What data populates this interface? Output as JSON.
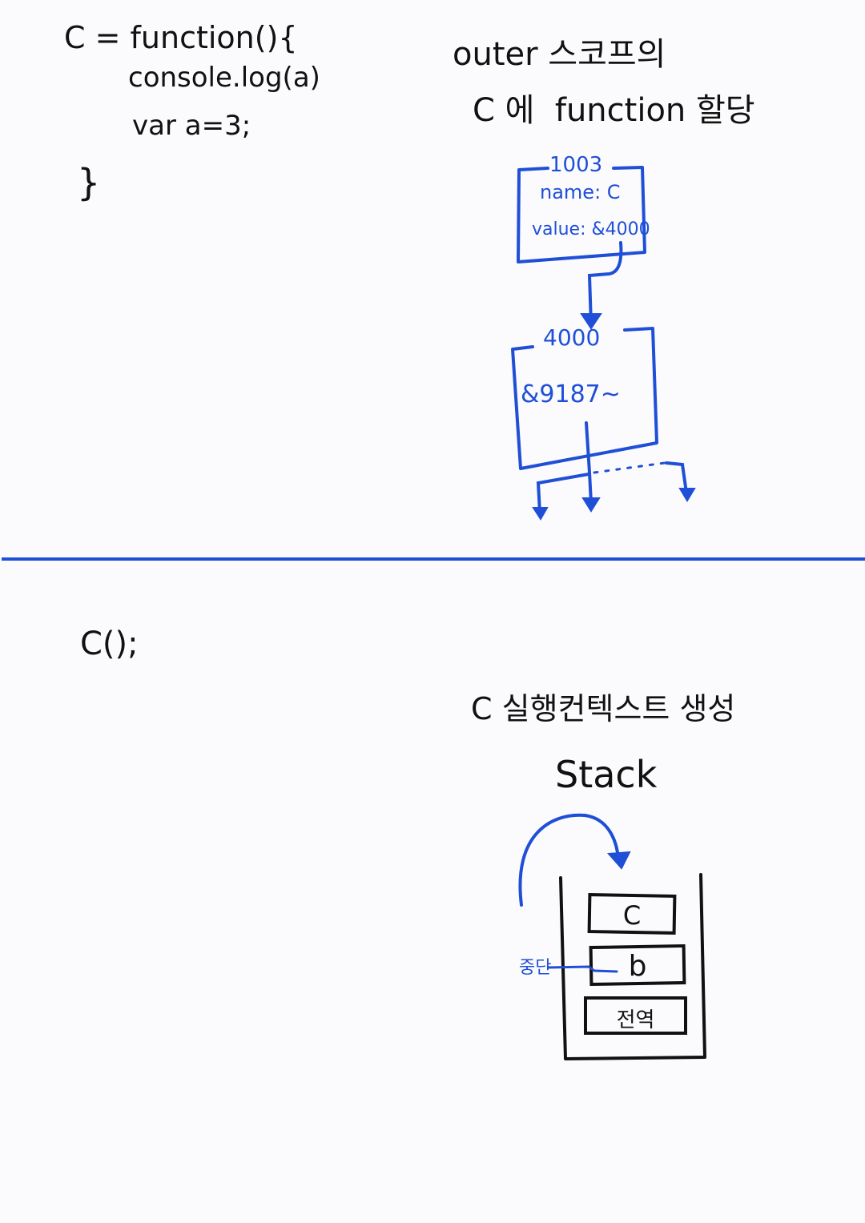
{
  "top": {
    "code": {
      "line1": "C = function(){",
      "line2": "console.log(a)",
      "line3": "var a=3;",
      "line4": "}"
    },
    "note": {
      "line1": "outer 스코프의",
      "line2": "C 에  function 할당"
    },
    "var_box": {
      "address": "1003",
      "name": "name: C",
      "value": "value: &4000"
    },
    "func_box": {
      "address": "4000",
      "content": "&9187~"
    }
  },
  "bottom": {
    "call": "C();",
    "note": {
      "line1": "C 실행컨텍스트 생성",
      "line2": "Stack"
    },
    "stack": {
      "items": [
        "C",
        "b",
        "전역"
      ],
      "pause_label": "중단"
    }
  },
  "colors": {
    "ink": "#111111",
    "accent": "#1f4fd6",
    "divider": "#1f4fd6",
    "background": "#fbfbfd"
  }
}
